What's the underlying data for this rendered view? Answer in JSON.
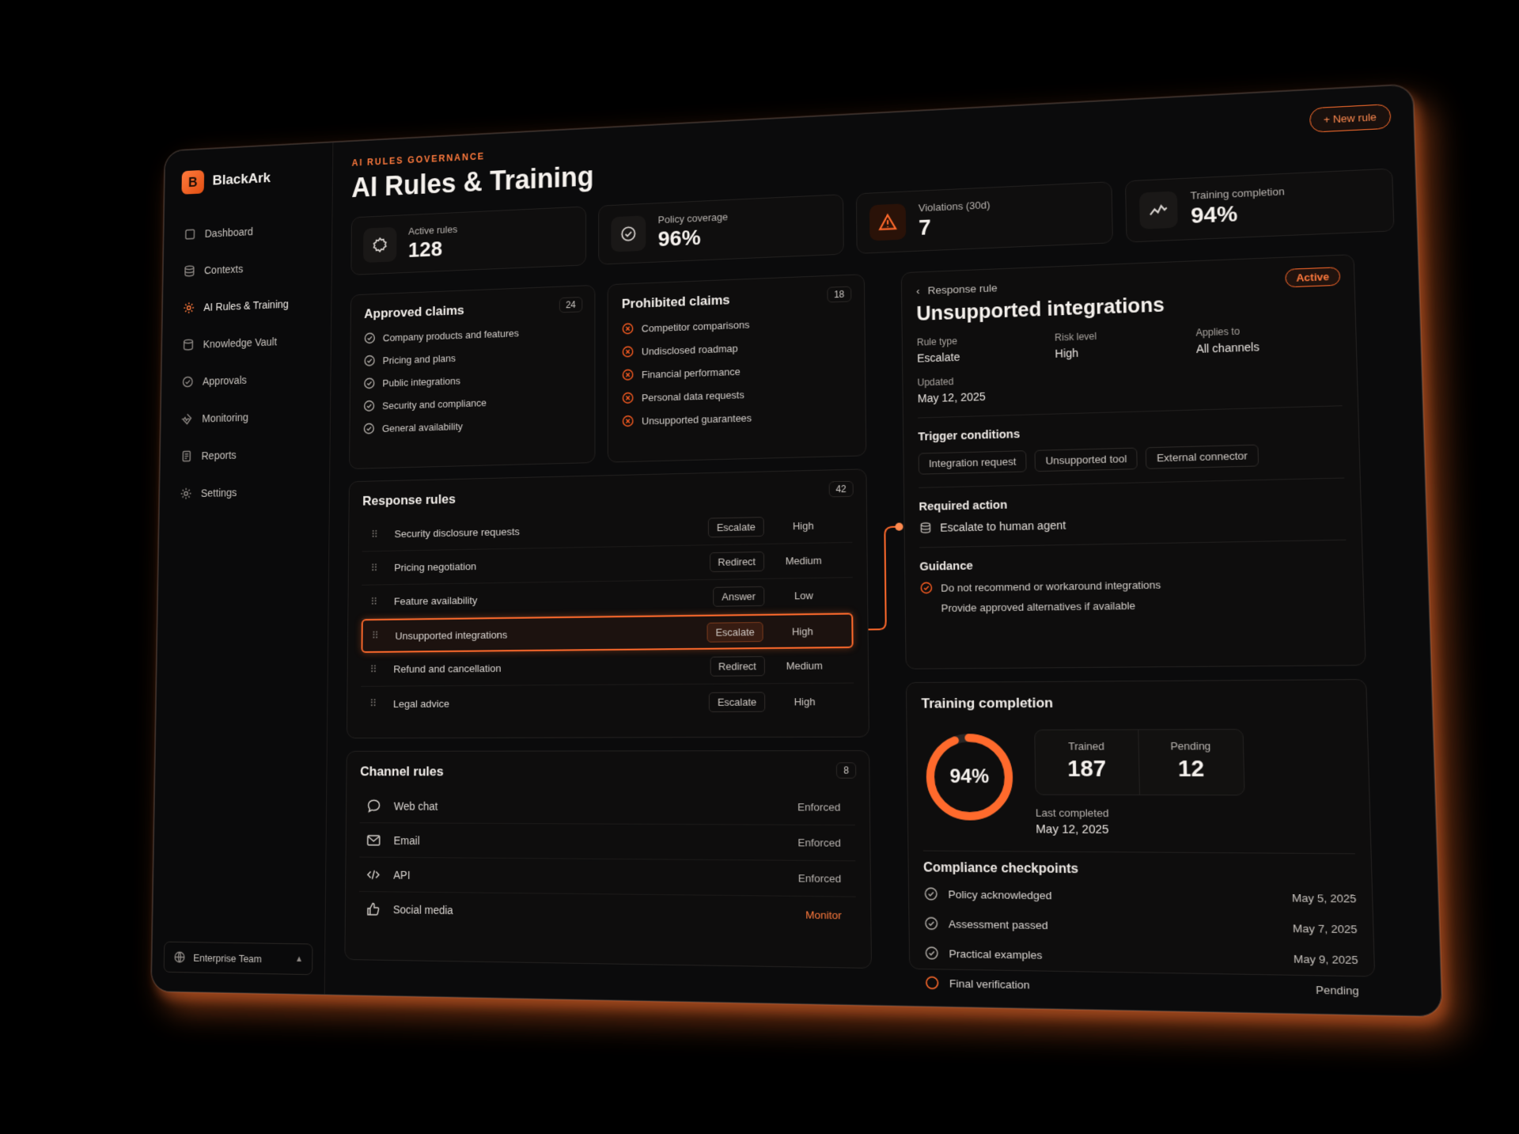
{
  "brand": {
    "logo_letter": "B",
    "name": "BlackArk"
  },
  "nav": {
    "items": [
      {
        "label": "Dashboard",
        "icon": "square-icon"
      },
      {
        "label": "Contexts",
        "icon": "database-icon"
      },
      {
        "label": "AI Rules & Training",
        "icon": "gear-icon",
        "active": true
      },
      {
        "label": "Knowledge Vault",
        "icon": "stack-icon"
      },
      {
        "label": "Approvals",
        "icon": "check-circle-icon"
      },
      {
        "label": "Monitoring",
        "icon": "pulse-icon"
      },
      {
        "label": "Reports",
        "icon": "document-icon"
      },
      {
        "label": "Settings",
        "icon": "gear-icon"
      }
    ],
    "team": "Enterprise Team"
  },
  "header": {
    "eyebrow": "AI RULES GOVERNANCE",
    "title": "AI Rules & Training",
    "new_rule": "+ New rule"
  },
  "stats": [
    {
      "label": "Active rules",
      "value": "128",
      "icon": "gear-icon"
    },
    {
      "label": "Policy coverage",
      "value": "96%",
      "icon": "check-circle-icon"
    },
    {
      "label": "Violations (30d)",
      "value": "7",
      "icon": "warning-icon"
    },
    {
      "label": "Training completion",
      "value": "94%",
      "icon": "trend-icon"
    }
  ],
  "approved": {
    "title": "Approved claims",
    "count": "24",
    "items": [
      "Company products and features",
      "Pricing and plans",
      "Public integrations",
      "Security and compliance",
      "General availability"
    ]
  },
  "prohibited": {
    "title": "Prohibited claims",
    "count": "18",
    "items": [
      "Competitor comparisons",
      "Undisclosed roadmap",
      "Financial performance",
      "Personal data requests",
      "Unsupported guarantees"
    ]
  },
  "response_rules": {
    "title": "Response rules",
    "count": "42",
    "rows": [
      {
        "name": "Security disclosure requests",
        "type": "Escalate",
        "risk": "High"
      },
      {
        "name": "Pricing negotiation",
        "type": "Redirect",
        "risk": "Medium"
      },
      {
        "name": "Feature availability",
        "type": "Answer",
        "risk": "Low"
      },
      {
        "name": "Unsupported integrations",
        "type": "Escalate",
        "risk": "High",
        "selected": true
      },
      {
        "name": "Refund and cancellation",
        "type": "Redirect",
        "risk": "Medium"
      },
      {
        "name": "Legal advice",
        "type": "Escalate",
        "risk": "High"
      }
    ]
  },
  "channel_rules": {
    "title": "Channel rules",
    "count": "8",
    "rows": [
      {
        "name": "Web chat",
        "status": "Enforced",
        "icon": "chat-icon"
      },
      {
        "name": "Email",
        "status": "Enforced",
        "icon": "mail-icon"
      },
      {
        "name": "API",
        "status": "Enforced",
        "icon": "code-icon"
      },
      {
        "name": "Social media",
        "status": "Monitor",
        "icon": "thumbs-up-icon"
      }
    ]
  },
  "detail": {
    "back_label": "Response rule",
    "status": "Active",
    "title": "Unsupported integrations",
    "rule_type_label": "Rule type",
    "rule_type": "Escalate",
    "risk_label": "Risk level",
    "risk": "High",
    "applies_label": "Applies to",
    "applies": "All channels",
    "updated_label": "Updated",
    "updated": "May 12, 2025",
    "trigger_label": "Trigger conditions",
    "triggers": [
      "Integration request",
      "Unsupported tool",
      "External connector"
    ],
    "action_label": "Required action",
    "action": "Escalate to human agent",
    "guidance_label": "Guidance",
    "guidance": [
      "Do not recommend or workaround integrations",
      "Provide approved alternatives if available"
    ]
  },
  "training": {
    "title": "Training completion",
    "percent_label": "94%",
    "progress": 0.94,
    "trained_label": "Trained",
    "trained": "187",
    "pending_label": "Pending",
    "pending": "12",
    "last_label": "Last completed",
    "last": "May 12, 2025",
    "accent": "#ff6a2c"
  },
  "compliance": {
    "title": "Compliance checkpoints",
    "rows": [
      {
        "name": "Policy acknowledged",
        "date": "May 5, 2025"
      },
      {
        "name": "Assessment passed",
        "date": "May 7, 2025"
      },
      {
        "name": "Practical examples",
        "date": "May 9, 2025"
      },
      {
        "name": "Final verification",
        "date": "Pending",
        "pending": true
      }
    ]
  }
}
